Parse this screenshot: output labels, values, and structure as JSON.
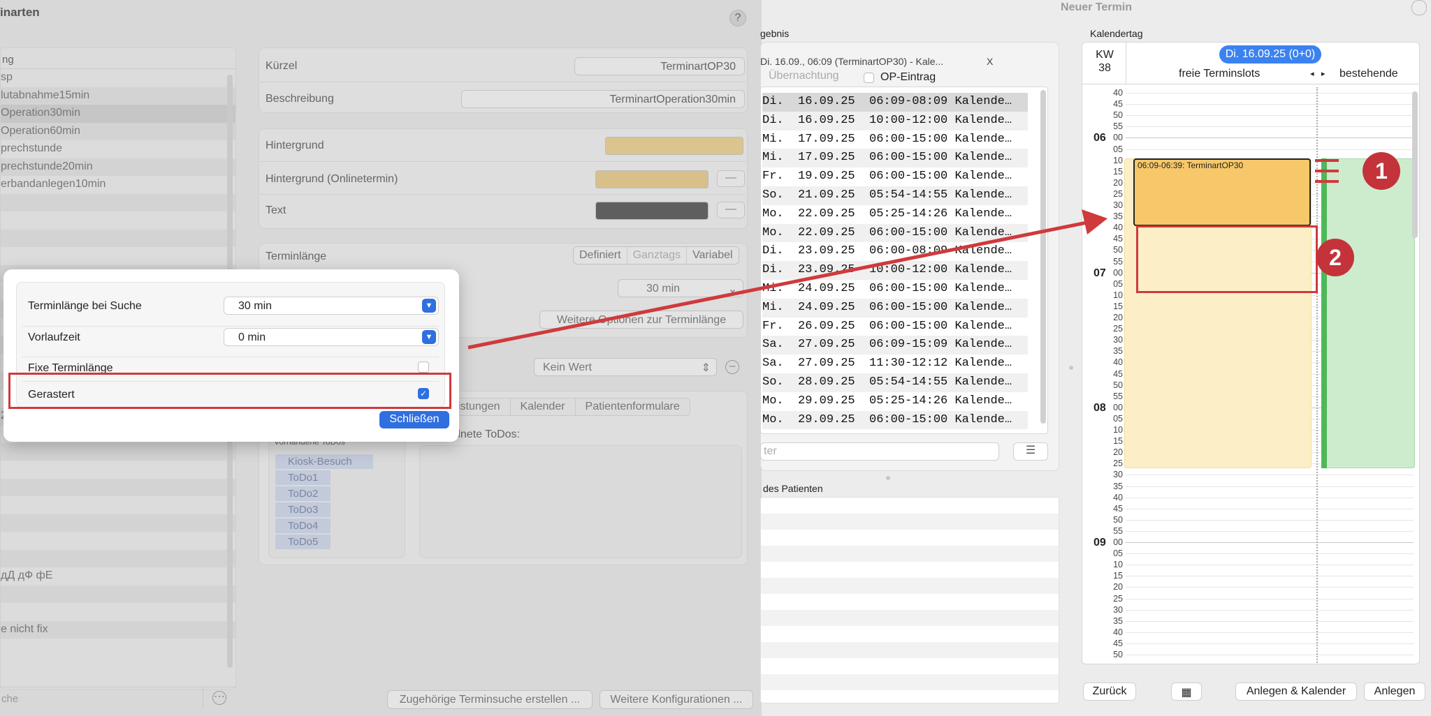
{
  "left_window": {
    "title": "inarten",
    "help": "?",
    "list_header": "ng",
    "types": [
      "sp",
      "lutabnahme15min",
      "Operation30min",
      "Operation60min",
      "prechstunde",
      "prechstunde20min",
      "erbandanlegen10min",
      "",
      "",
      "",
      "",
      "",
      "",
      "",
      "",
      "",
      "",
      "",
      "",
      "2ÄÜö ;: nüscht",
      "",
      "",
      "",
      "",
      "",
      "",
      "",
      "",
      "дД дФ фЕ",
      "",
      "",
      "e nicht fix"
    ],
    "search_placeholder": "che",
    "kuerzel_label": "Kürzel",
    "kuerzel_value": "TerminartOP30",
    "beschreibung_label": "Beschreibung",
    "beschreibung_value": "TerminartOperation30min",
    "hintergrund_label": "Hintergrund",
    "hintergrund_online_label": "Hintergrund (Onlinetermin)",
    "text_label": "Text",
    "terminlaenge_label": "Terminlänge",
    "seg_options": [
      "Definiert",
      "Ganztags",
      "Variabel"
    ],
    "duration_value": "30 min",
    "more_options": "Weitere Optionen zur Terminlänge",
    "kein_wert": "Kein Wert",
    "tabs": [
      "istungen",
      "Kalender",
      "Patientenformulare"
    ],
    "vorhandene_todos_label": "Vorhandene ToDos",
    "zugeordnete_todos_label": "dnete ToDos:",
    "todos": [
      "Kiosk-Besuch",
      "ToDo1",
      "ToDo2",
      "ToDo3",
      "ToDo4",
      "ToDo5"
    ],
    "btn_terminsuche": "Zugehörige Terminsuche erstellen ...",
    "btn_weitere_konfig": "Weitere Konfigurationen ..."
  },
  "popup": {
    "suche_label": "Terminlänge bei Suche",
    "suche_value": "30 min",
    "vorlauf_label": "Vorlaufzeit",
    "vorlauf_value": "0 min",
    "fixe_label": "Fixe Terminlänge",
    "gerastert_label": "Gerastert",
    "close_button": "Schließen"
  },
  "right_window": {
    "title": "Neuer Termin",
    "ergebnis_label": "gebnis",
    "result_header": "Di. 16.09., 06:09 (TerminartOP30) - Kale...",
    "result_close": "X",
    "uebernachtung": "Übernachtung",
    "op_eintrag": "OP-Eintrag",
    "results": [
      "Di.  16.09.25  06:09-08:09 Kalende…",
      "Di.  16.09.25  10:00-12:00 Kalende…",
      "Mi.  17.09.25  06:00-15:00 Kalende…",
      "Mi.  17.09.25  06:00-15:00 Kalende…",
      "Fr.  19.09.25  06:00-15:00 Kalende…",
      "So.  21.09.25  05:54-14:55 Kalende…",
      "Mo.  22.09.25  05:25-14:26 Kalende…",
      "Mo.  22.09.25  06:00-15:00 Kalende…",
      "Di.  23.09.25  06:00-08:09 Kalende…",
      "Di.  23.09.25  10:00-12:00 Kalende…",
      "Mi.  24.09.25  06:00-15:00 Kalende…",
      "Mi.  24.09.25  06:00-15:00 Kalende…",
      "Fr.  26.09.25  06:00-15:00 Kalende…",
      "Sa.  27.09.25  06:09-15:09 Kalende…",
      "Sa.  27.09.25  11:30-12:12 Kalende…",
      "So.  28.09.25  05:54-14:55 Kalende…",
      "Mo.  29.09.25  05:25-14:26 Kalende…",
      "Mo.  29.09.25  06:00-15:00 Kalende…"
    ],
    "filter_placeholder": "ter",
    "patient_label": "des Patienten",
    "kalendertag_label": "Kalendertag",
    "date_pill": "Di. 16.09.25 (0+0)",
    "kw_label": "KW",
    "kw_value": "38",
    "freie_label": "freie Terminslots",
    "bestehende_label": "bestehende",
    "appointment_text": "06:09-06:39: TerminartOP30",
    "hours": [
      "06",
      "07",
      "08",
      "09"
    ],
    "minute_ticks": [
      "40",
      "45",
      "50",
      "55",
      "00",
      "05",
      "10",
      "15",
      "20",
      "25",
      "30",
      "35",
      "40",
      "45",
      "50",
      "55",
      "00",
      "05",
      "10",
      "15",
      "20",
      "25",
      "30",
      "35",
      "40",
      "45",
      "50",
      "55",
      "00",
      "05",
      "10",
      "15",
      "20",
      "25",
      "30",
      "35",
      "40",
      "45",
      "50",
      "55",
      "00",
      "05",
      "10",
      "15",
      "20",
      "25",
      "30",
      "35",
      "40",
      "45",
      "50"
    ],
    "btn_zurueck": "Zurück",
    "btn_anlegen_kalender": "Anlegen & Kalender",
    "btn_anlegen": "Anlegen"
  },
  "annotations": {
    "badge1": "1",
    "badge2": "2"
  },
  "colors": {
    "appointment": "#f7c86a",
    "free_slot": "#fcefc7",
    "existing": "#cdeccd",
    "highlight": "#cf3a3d",
    "accent": "#2f6fe0"
  }
}
